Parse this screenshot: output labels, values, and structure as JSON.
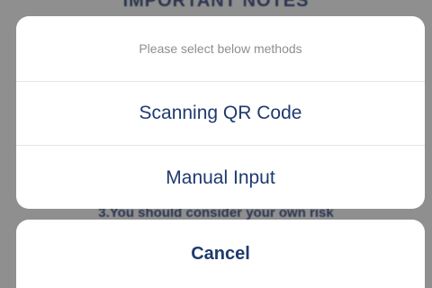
{
  "background": {
    "heading": "IMPORTANT NOTES",
    "note": "3.You should consider your own risk"
  },
  "action_sheet": {
    "title": "Please select below methods",
    "options": [
      {
        "label": "Scanning QR Code"
      },
      {
        "label": "Manual Input"
      }
    ],
    "cancel_label": "Cancel"
  },
  "colors": {
    "overlay": "#8f8f8f",
    "sheet_bg": "#ffffff",
    "option_text": "#1e3a6e",
    "title_text": "#8e8e93",
    "divider": "#e5e5e5"
  }
}
